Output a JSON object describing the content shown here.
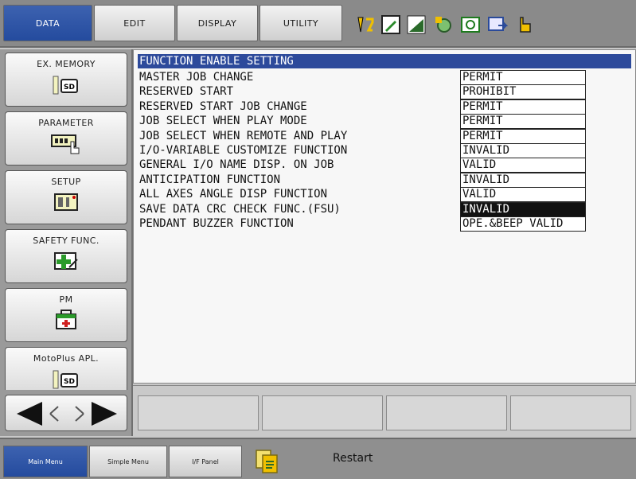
{
  "top_menu": {
    "tabs": [
      {
        "label": "DATA",
        "active": true
      },
      {
        "label": "EDIT",
        "active": false
      },
      {
        "label": "DISPLAY",
        "active": false
      },
      {
        "label": "UTILITY",
        "active": false
      }
    ],
    "status_icons": [
      "axis-arrows-icon",
      "edit-mode-icon",
      "signal-bars-icon",
      "robot-gear-icon",
      "camera-icon",
      "monitor-arrow-icon",
      "pointing-hand-icon"
    ]
  },
  "sidebar": {
    "items": [
      {
        "label": "EX. MEMORY",
        "icon": "sd-card-icon"
      },
      {
        "label": "PARAMETER",
        "icon": "parameter-hand-icon"
      },
      {
        "label": "SETUP",
        "icon": "setup-panel-icon"
      },
      {
        "label": "SAFETY FUNC.",
        "icon": "safety-cross-icon"
      },
      {
        "label": "PM",
        "icon": "medical-kit-icon"
      },
      {
        "label": "MotoPlus APL.",
        "icon": "sd-card-icon"
      }
    ]
  },
  "main": {
    "title": "FUNCTION ENABLE SETTING",
    "rows": [
      {
        "label": "MASTER JOB CHANGE",
        "value": "PERMIT"
      },
      {
        "label": "RESERVED START",
        "value": "PROHIBIT"
      },
      {
        "label": "RESERVED START JOB CHANGE",
        "value": "PERMIT"
      },
      {
        "label": "JOB SELECT WHEN PLAY MODE",
        "value": "PERMIT"
      },
      {
        "label": "JOB SELECT WHEN REMOTE AND PLAY",
        "value": "PERMIT"
      },
      {
        "label": "I/O-VARIABLE CUSTOMIZE FUNCTION",
        "value": "INVALID"
      },
      {
        "label": "GENERAL I/O NAME DISP. ON JOB",
        "value": "VALID"
      },
      {
        "label": "ANTICIPATION FUNCTION",
        "value": "INVALID"
      },
      {
        "label": "ALL AXES ANGLE DISP FUNCTION",
        "value": "VALID"
      },
      {
        "label": "SAVE DATA CRC CHECK FUNC.(FSU)",
        "value": "INVALID",
        "selected": true
      },
      {
        "label": "PENDANT BUZZER FUNCTION",
        "value": "OPE.&BEEP VALID"
      }
    ]
  },
  "footer": {
    "tabs": [
      "Main Menu",
      "Simple Menu",
      "I/F Panel"
    ],
    "restart_label": "Restart"
  },
  "colors": {
    "accent": "#2d4a9b",
    "selected_bg": "#111111",
    "panel": "#f7f7f7"
  }
}
